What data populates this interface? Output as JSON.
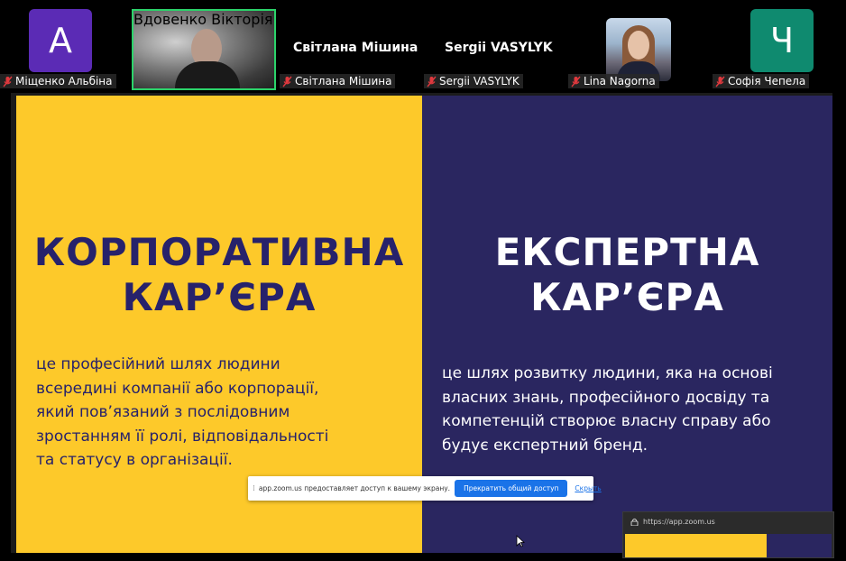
{
  "participants": [
    {
      "name": "Міщенко Альбіна",
      "avatar_letter": "А",
      "avatar_color": "#5b2bb5",
      "muted": true
    },
    {
      "name": "Вдовенко Вікторія",
      "video": true,
      "active_speaker": true,
      "muted": false
    },
    {
      "name": "Світлана Мішина",
      "big_name": "Світлана Мішина",
      "muted": true
    },
    {
      "name": "Sergii VASYLYK",
      "big_name": "Sergii VASYLYK",
      "muted": true
    },
    {
      "name": "Lina Nagorna",
      "photo": true,
      "muted": true
    },
    {
      "name": "Софія Чепела",
      "avatar_letter": "Ч",
      "avatar_color": "#0f8a6f",
      "muted": true
    }
  ],
  "slide": {
    "left": {
      "heading": "КОРПОРАТИВНА\nКАР’ЄРА",
      "description": "це професійний шлях людини всередині компанії або корпорації, який пов’язаний з послідовним зростанням її ролі, відповідальності та статусу в організації.",
      "bg_color": "#fdc92a",
      "text_color": "#27226b"
    },
    "right": {
      "heading": "ЕКСПЕРТНА\nКАР’ЄРА",
      "description": "це шлях розвитку людини, яка на основі власних знань, професійного досвіду та компетенцій створює власну справу або будує експертний бренд.",
      "bg_color": "#2a2660",
      "text_color": "#ffffff"
    }
  },
  "share_banner": {
    "message": "app.zoom.us предоставляет доступ к вашему экрану.",
    "stop_button": "Прекратить общий доступ",
    "hide_link": "Скрыть"
  },
  "mini_window": {
    "url": "https://app.zoom.us"
  },
  "colors": {
    "active_speaker_border": "#2bd36a",
    "mute_icon": "#e0393e",
    "link_blue": "#1a73e8"
  }
}
